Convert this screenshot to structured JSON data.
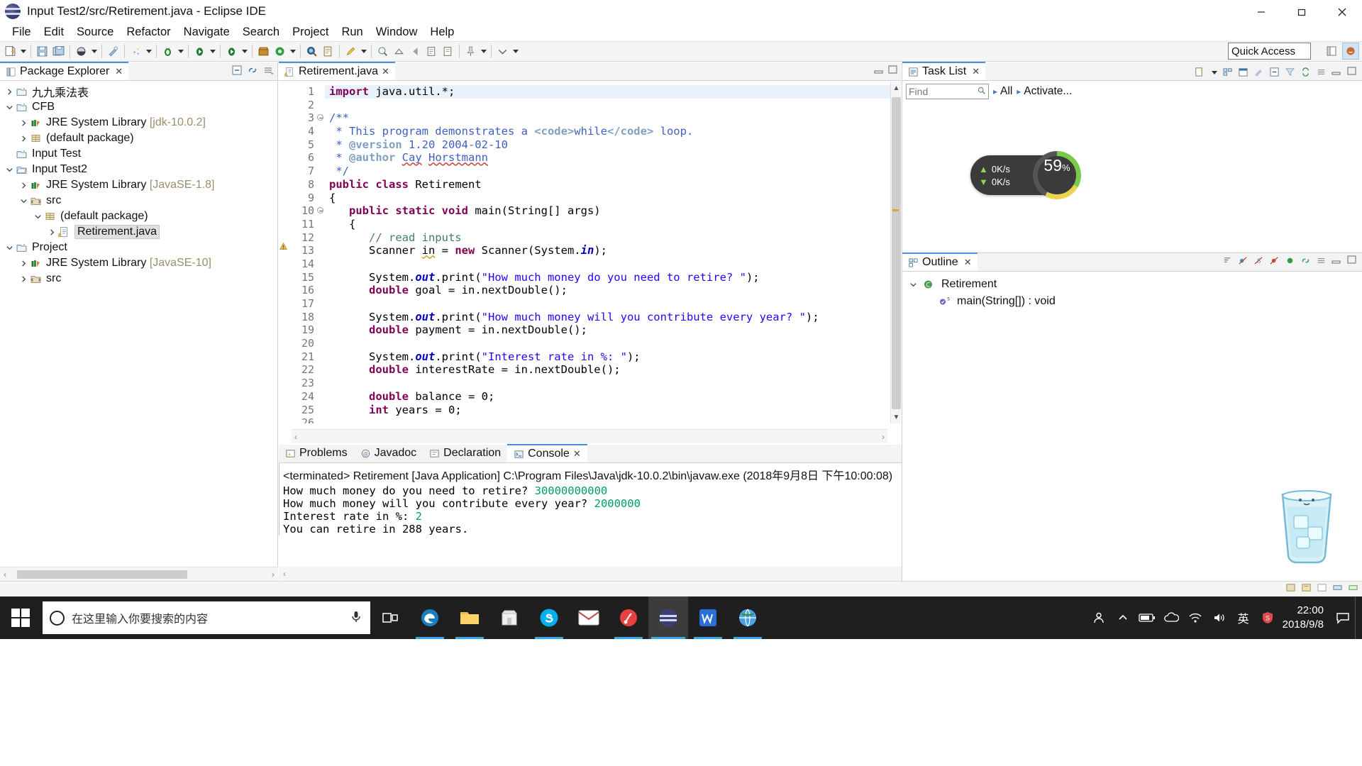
{
  "window": {
    "title": "Input Test2/src/Retirement.java - Eclipse IDE",
    "app_icon": "eclipse-icon",
    "minimize": "—",
    "maximize": "❐",
    "close": "✕"
  },
  "menubar": {
    "items": [
      "File",
      "Edit",
      "Source",
      "Refactor",
      "Navigate",
      "Search",
      "Project",
      "Run",
      "Window",
      "Help"
    ]
  },
  "toolbar": {
    "quick_access_placeholder": "Quick Access",
    "groups": [
      [
        "new-wizard-icon",
        "dropdown-arrow"
      ],
      [
        "save-icon",
        "save-all-icon"
      ],
      [
        "print-icon",
        "dropdown-arrow"
      ],
      [
        "external-tools-icon"
      ],
      [
        "new-java-project-icon",
        "dropdown-arrow"
      ],
      [
        "debug-icon",
        "dropdown-arrow"
      ],
      [
        "run-icon",
        "dropdown-arrow"
      ],
      [
        "run-external-icon",
        "dropdown-arrow"
      ],
      [
        "coverage-icon",
        "profile-icon",
        "dropdown-arrow"
      ],
      [
        "search-icon",
        "open-type-icon"
      ],
      [
        "edit-icon",
        "dropdown-arrow"
      ],
      [
        "next-annotation-icon",
        "previous-annotation-icon"
      ],
      [
        "back-icon",
        "forward-icon"
      ],
      [
        "pin-icon",
        "dropdown-arrow"
      ],
      [
        "more-icon"
      ]
    ]
  },
  "package_explorer": {
    "tab_label": "Package Explorer",
    "tab_icon": "package-explorer-icon",
    "tools": [
      "collapse-all-icon",
      "link-with-editor-icon",
      "view-menu-icon"
    ],
    "tree": [
      {
        "indent": 0,
        "twisty": "collapsed",
        "icon": "java-project-icon",
        "label": "九九乘法表",
        "sub": ""
      },
      {
        "indent": 0,
        "twisty": "expanded",
        "icon": "java-project-icon",
        "label": "CFB",
        "sub": ""
      },
      {
        "indent": 1,
        "twisty": "collapsed",
        "icon": "jre-library-icon",
        "label": "JRE System Library",
        "sub": "[jdk-10.0.2]"
      },
      {
        "indent": 1,
        "twisty": "collapsed",
        "icon": "package-icon",
        "label": "(default package)",
        "sub": ""
      },
      {
        "indent": 0,
        "twisty": "none",
        "icon": "java-project-icon",
        "label": "Input Test",
        "sub": ""
      },
      {
        "indent": 0,
        "twisty": "expanded",
        "icon": "java-project-open-icon",
        "label": "Input Test2",
        "sub": ""
      },
      {
        "indent": 1,
        "twisty": "collapsed",
        "icon": "jre-library-icon",
        "label": "JRE System Library",
        "sub": "[JavaSE-1.8]"
      },
      {
        "indent": 1,
        "twisty": "expanded",
        "icon": "source-folder-icon",
        "label": "src",
        "sub": ""
      },
      {
        "indent": 2,
        "twisty": "expanded",
        "icon": "package-icon",
        "label": "(default package)",
        "sub": ""
      },
      {
        "indent": 3,
        "twisty": "collapsed",
        "icon": "java-file-icon",
        "label": "Retirement.java",
        "sub": "",
        "selected": true
      },
      {
        "indent": 0,
        "twisty": "expanded",
        "icon": "java-project-icon",
        "label": "Project",
        "sub": ""
      },
      {
        "indent": 1,
        "twisty": "collapsed",
        "icon": "jre-library-icon",
        "label": "JRE System Library",
        "sub": "[JavaSE-10]"
      },
      {
        "indent": 1,
        "twisty": "collapsed",
        "icon": "source-folder-icon",
        "label": "src",
        "sub": ""
      }
    ],
    "hscroll_left": "‹",
    "hscroll_right": "›"
  },
  "editor": {
    "tab_label": "Retirement.java",
    "tab_icon": "java-file-warning-icon",
    "minimize_icon": "minimize-icon",
    "maximize_icon": "maximize-icon",
    "lines": [
      {
        "n": 1,
        "fold": "",
        "marker": "",
        "highlight": true,
        "tokens": [
          {
            "t": "import ",
            "c": "kw"
          },
          {
            "t": "java.util.*;",
            "c": ""
          }
        ]
      },
      {
        "n": 2,
        "fold": "",
        "marker": "",
        "tokens": []
      },
      {
        "n": 3,
        "fold": "minus",
        "marker": "",
        "tokens": [
          {
            "t": "/**",
            "c": "jdoc"
          }
        ]
      },
      {
        "n": 4,
        "fold": "",
        "marker": "",
        "tokens": [
          {
            "t": " * This program demonstrates a ",
            "c": "jdoc"
          },
          {
            "t": "<code>",
            "c": "jdoc-tag"
          },
          {
            "t": "while",
            "c": "jdoc"
          },
          {
            "t": "</code>",
            "c": "jdoc-tag"
          },
          {
            "t": " loop.",
            "c": "jdoc"
          }
        ]
      },
      {
        "n": 5,
        "fold": "",
        "marker": "",
        "tokens": [
          {
            "t": " * ",
            "c": "jdoc"
          },
          {
            "t": "@version",
            "c": "jdoc-tag"
          },
          {
            "t": " 1.20 2004-02-10",
            "c": "jdoc"
          }
        ]
      },
      {
        "n": 6,
        "fold": "",
        "marker": "",
        "tokens": [
          {
            "t": " * ",
            "c": "jdoc"
          },
          {
            "t": "@author",
            "c": "jdoc-tag"
          },
          {
            "t": " ",
            "c": "jdoc"
          },
          {
            "t": "Cay",
            "c": "jdoc sq2"
          },
          {
            "t": " ",
            "c": "jdoc"
          },
          {
            "t": "Horstmann",
            "c": "jdoc sq2"
          }
        ]
      },
      {
        "n": 7,
        "fold": "",
        "marker": "",
        "tokens": [
          {
            "t": " */",
            "c": "jdoc"
          }
        ]
      },
      {
        "n": 8,
        "fold": "",
        "marker": "",
        "tokens": [
          {
            "t": "public class ",
            "c": "kw"
          },
          {
            "t": "Retirement",
            "c": ""
          }
        ]
      },
      {
        "n": 9,
        "fold": "",
        "marker": "",
        "tokens": [
          {
            "t": "{",
            "c": ""
          }
        ]
      },
      {
        "n": 10,
        "fold": "minus",
        "marker": "",
        "tokens": [
          {
            "t": "   ",
            "c": ""
          },
          {
            "t": "public static void ",
            "c": "kw"
          },
          {
            "t": "main(String[] args)",
            "c": ""
          }
        ]
      },
      {
        "n": 11,
        "fold": "",
        "marker": "",
        "tokens": [
          {
            "t": "   {",
            "c": ""
          }
        ]
      },
      {
        "n": 12,
        "fold": "",
        "marker": "",
        "tokens": [
          {
            "t": "      // read inputs",
            "c": "cmt"
          }
        ]
      },
      {
        "n": 13,
        "fold": "",
        "marker": "warning",
        "tokens": [
          {
            "t": "      Scanner ",
            "c": ""
          },
          {
            "t": "in",
            "c": "sq"
          },
          {
            "t": " = ",
            "c": ""
          },
          {
            "t": "new ",
            "c": "kw"
          },
          {
            "t": "Scanner(System.",
            "c": ""
          },
          {
            "t": "in",
            "c": "fld"
          },
          {
            "t": ");",
            "c": ""
          }
        ]
      },
      {
        "n": 14,
        "fold": "",
        "marker": "",
        "tokens": []
      },
      {
        "n": 15,
        "fold": "",
        "marker": "",
        "tokens": [
          {
            "t": "      System.",
            "c": ""
          },
          {
            "t": "out",
            "c": "fld"
          },
          {
            "t": ".print(",
            "c": ""
          },
          {
            "t": "\"How much money do you need to retire? \"",
            "c": "str"
          },
          {
            "t": ");",
            "c": ""
          }
        ]
      },
      {
        "n": 16,
        "fold": "",
        "marker": "",
        "tokens": [
          {
            "t": "      ",
            "c": ""
          },
          {
            "t": "double ",
            "c": "kw"
          },
          {
            "t": "goal = in.nextDouble();",
            "c": ""
          }
        ]
      },
      {
        "n": 17,
        "fold": "",
        "marker": "",
        "tokens": []
      },
      {
        "n": 18,
        "fold": "",
        "marker": "",
        "tokens": [
          {
            "t": "      System.",
            "c": ""
          },
          {
            "t": "out",
            "c": "fld"
          },
          {
            "t": ".print(",
            "c": ""
          },
          {
            "t": "\"How much money will you contribute every year? \"",
            "c": "str"
          },
          {
            "t": ");",
            "c": ""
          }
        ]
      },
      {
        "n": 19,
        "fold": "",
        "marker": "",
        "tokens": [
          {
            "t": "      ",
            "c": ""
          },
          {
            "t": "double ",
            "c": "kw"
          },
          {
            "t": "payment = in.nextDouble();",
            "c": ""
          }
        ]
      },
      {
        "n": 20,
        "fold": "",
        "marker": "",
        "tokens": []
      },
      {
        "n": 21,
        "fold": "",
        "marker": "",
        "tokens": [
          {
            "t": "      System.",
            "c": ""
          },
          {
            "t": "out",
            "c": "fld"
          },
          {
            "t": ".print(",
            "c": ""
          },
          {
            "t": "\"Interest rate in %: \"",
            "c": "str"
          },
          {
            "t": ");",
            "c": ""
          }
        ]
      },
      {
        "n": 22,
        "fold": "",
        "marker": "",
        "tokens": [
          {
            "t": "      ",
            "c": ""
          },
          {
            "t": "double ",
            "c": "kw"
          },
          {
            "t": "interestRate = in.nextDouble();",
            "c": ""
          }
        ]
      },
      {
        "n": 23,
        "fold": "",
        "marker": "",
        "tokens": []
      },
      {
        "n": 24,
        "fold": "",
        "marker": "",
        "tokens": [
          {
            "t": "      ",
            "c": ""
          },
          {
            "t": "double ",
            "c": "kw"
          },
          {
            "t": "balance = 0;",
            "c": ""
          }
        ]
      },
      {
        "n": 25,
        "fold": "",
        "marker": "",
        "tokens": [
          {
            "t": "      ",
            "c": ""
          },
          {
            "t": "int ",
            "c": "kw"
          },
          {
            "t": "years = 0;",
            "c": ""
          }
        ]
      },
      {
        "n": 26,
        "fold": "",
        "marker": "",
        "tokens": []
      }
    ],
    "scroll_up": "▲",
    "scroll_down": "▼",
    "hscroll_left": "‹",
    "hscroll_right": "›"
  },
  "console": {
    "tabs": [
      {
        "label": "Problems",
        "icon": "problems-icon",
        "active": false
      },
      {
        "label": "Javadoc",
        "icon": "javadoc-icon",
        "active": false
      },
      {
        "label": "Declaration",
        "icon": "declaration-icon",
        "active": false
      },
      {
        "label": "Console",
        "icon": "console-icon",
        "active": true
      }
    ],
    "tools": [
      "terminate-icon",
      "remove-launch-icon",
      "remove-all-icon",
      "clear-console-icon",
      "scroll-lock-icon",
      "word-wrap-icon",
      "pin-console-icon",
      "display-selected-icon",
      "open-console-icon",
      "dropdown-arrow",
      "new-console-view-icon",
      "dropdown-arrow",
      "minimize-icon",
      "maximize-icon"
    ],
    "header": "<terminated> Retirement [Java Application] C:\\Program Files\\Java\\jdk-10.0.2\\bin\\javaw.exe (2018年9月8日 下午10:00:08)",
    "output": [
      {
        "prompt": "How much money do you need to retire? ",
        "value": "30000000000"
      },
      {
        "prompt": "How much money will you contribute every year? ",
        "value": "2000000"
      },
      {
        "prompt": "Interest rate in %: ",
        "value": "2"
      },
      {
        "prompt": "You can retire in 288 years.",
        "value": ""
      }
    ],
    "hscroll_left": "‹",
    "hscroll_right": "›"
  },
  "task_list": {
    "tab_label": "Task List",
    "tab_icon": "task-list-icon",
    "tools": [
      "new-task-icon",
      "dropdown-arrow",
      "categorize-icon",
      "schedule-icon",
      "focus-icon",
      "collapse-all-icon",
      "filter-icon",
      "synchronize-icon",
      "view-menu-icon",
      "minimize-icon",
      "maximize-icon"
    ],
    "find_placeholder": "Find",
    "find_value": "",
    "all_label": "All",
    "activate_label": "Activate...",
    "gauge": {
      "up_speed": "0K/s",
      "down_speed": "0K/s",
      "percent": "59",
      "percent_unit": "%"
    }
  },
  "outline": {
    "tab_label": "Outline",
    "tab_icon": "outline-icon",
    "tools": [
      "sort-icon",
      "hide-fields-icon",
      "hide-static-icon",
      "hide-nonpublic-icon",
      "focus-icon",
      "link-icon",
      "view-menu-icon",
      "minimize-icon",
      "maximize-icon"
    ],
    "items": [
      {
        "indent": 0,
        "twisty": "expanded",
        "icon": "java-class-icon",
        "label": "Retirement",
        "sub": ""
      },
      {
        "indent": 1,
        "twisty": "none",
        "icon": "method-static-icon",
        "label": "main(String[])",
        "sub": " : void"
      }
    ]
  },
  "status_bar": {
    "right_icons": [
      "writable-icon",
      "smart-insert-icon",
      "position-icon",
      "build-icon",
      "heap-icon"
    ]
  },
  "taskbar": {
    "start_icon": "windows-logo",
    "search_placeholder": "在这里输入你要搜索的内容",
    "mic_icon": "microphone-icon",
    "task_view_icon": "task-view-icon",
    "apps": [
      {
        "icon": "edge-icon",
        "running": true
      },
      {
        "icon": "file-explorer-icon",
        "running": true
      },
      {
        "icon": "microsoft-store-icon",
        "running": false
      },
      {
        "icon": "skype-icon",
        "running": true
      },
      {
        "icon": "mail-icon",
        "running": false
      },
      {
        "icon": "music-app-icon",
        "running": true
      },
      {
        "icon": "eclipse-icon",
        "running": true,
        "active": true
      },
      {
        "icon": "wps-writer-icon",
        "running": true
      },
      {
        "icon": "browser-globe-icon",
        "running": true
      }
    ],
    "tray": [
      "people-icon",
      "show-hidden-icons-icon",
      "battery-icon",
      "onedrive-icon",
      "network-icon",
      "volume-icon",
      "ime-icon",
      "security-icon"
    ],
    "ime_label": "英",
    "clock_time": "22:00",
    "clock_date": "2018/9/8",
    "notification_icon": "notification-icon"
  }
}
